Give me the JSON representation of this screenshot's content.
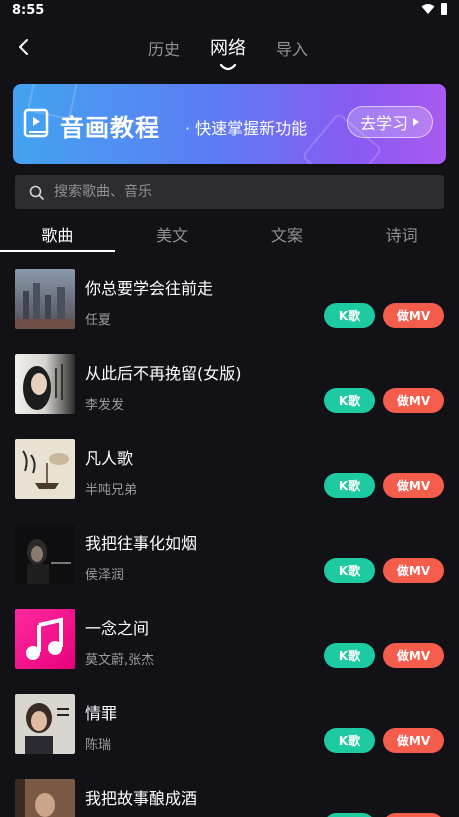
{
  "status": {
    "time": "8:55"
  },
  "nav": {
    "tabs": [
      "历史",
      "网络",
      "导入"
    ],
    "active_tab": 1
  },
  "banner": {
    "title": "音画教程",
    "subtitle": "· 快速掌握新功能",
    "button_label": "去学习"
  },
  "search": {
    "placeholder": "搜索歌曲、音乐"
  },
  "categories": [
    "歌曲",
    "美文",
    "文案",
    "诗词"
  ],
  "active_category": 0,
  "songs": [
    {
      "title": "你总要学会往前走",
      "artist": "任夏"
    },
    {
      "title": "从此后不再挽留(女版)",
      "artist": "李发发"
    },
    {
      "title": "凡人歌",
      "artist": "半吨兄弟"
    },
    {
      "title": "我把往事化如烟",
      "artist": "侯泽润"
    },
    {
      "title": "一念之间",
      "artist": "莫文蔚,张杰"
    },
    {
      "title": "情罪",
      "artist": "陈瑞"
    },
    {
      "title": "我把故事酿成酒",
      "artist": ""
    }
  ],
  "actions": {
    "k_label": "K歌",
    "mv_label": "做MV"
  },
  "colors": {
    "background": "#111116",
    "k_button": "#1ecaa2",
    "mv_button": "#f45c4c"
  }
}
